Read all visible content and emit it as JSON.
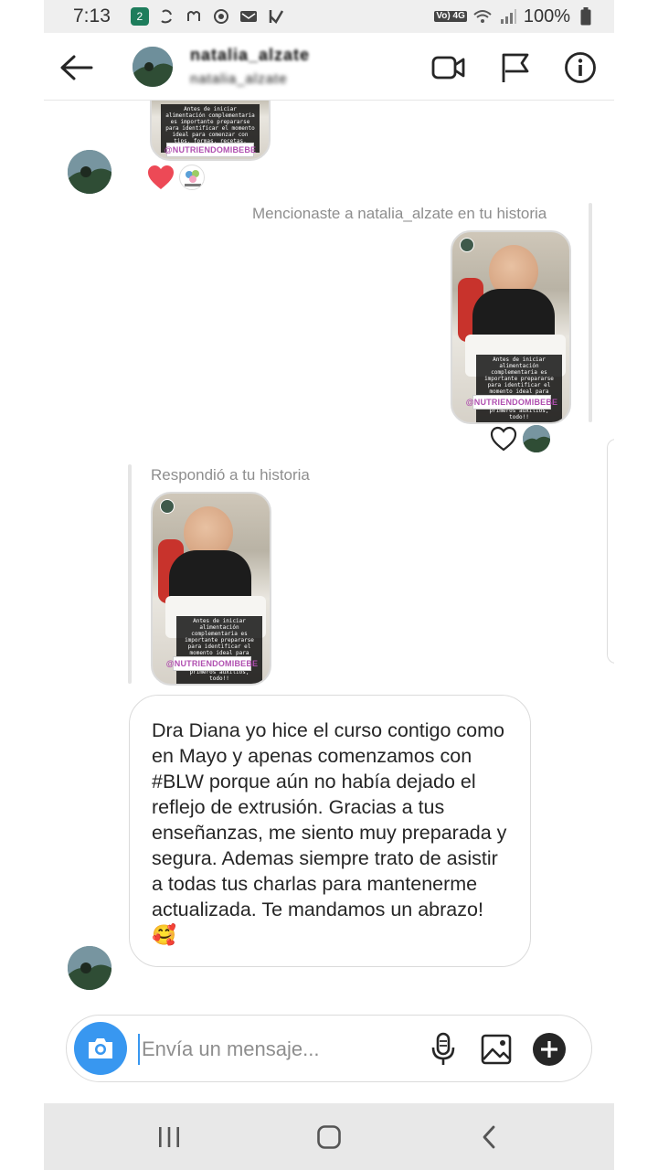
{
  "status_bar": {
    "time": "7:13",
    "notification_count": "2",
    "network": "Vo) 4G",
    "battery": "100%"
  },
  "header": {
    "username": "natalia_alzate",
    "subtitle": "natalia_alzate"
  },
  "messages": {
    "story_1_text": "Antes de iniciar alimentación complementaria es importante prepararse para identificar el momento ideal para comenzar con tips, formas, recetas, primeros auxilios, todo!!",
    "story_tag": "@NUTRIENDOMIBEBE",
    "mention_label": "Mencionaste a natalia_alzate en tu historia",
    "reply_label": "Respondió a tu historia",
    "text_message": "Dra Diana yo hice el curso contigo como en Mayo y apenas comenzamos con #BLW porque aún no había dejado el reflejo de extrusión. Gracias a tus enseñanzas, me siento muy preparada y segura. Ademas siempre trato de asistir a todas tus charlas para mantenerme actualizada. Te mandamos un abrazo! 🥰",
    "reaction_logo_text": "NUTRIENDO MI BEBE"
  },
  "composer": {
    "placeholder": "Envía un mensaje..."
  },
  "colors": {
    "accent": "#3897f0",
    "heart": "#ed4956",
    "tag_text": "#b04fb0"
  },
  "icons": {
    "back": "arrow-left-icon",
    "video": "video-camera-icon",
    "flag": "flag-icon",
    "info": "info-icon",
    "camera": "camera-icon",
    "mic": "microphone-icon",
    "gallery": "image-icon",
    "plus": "plus-icon"
  }
}
